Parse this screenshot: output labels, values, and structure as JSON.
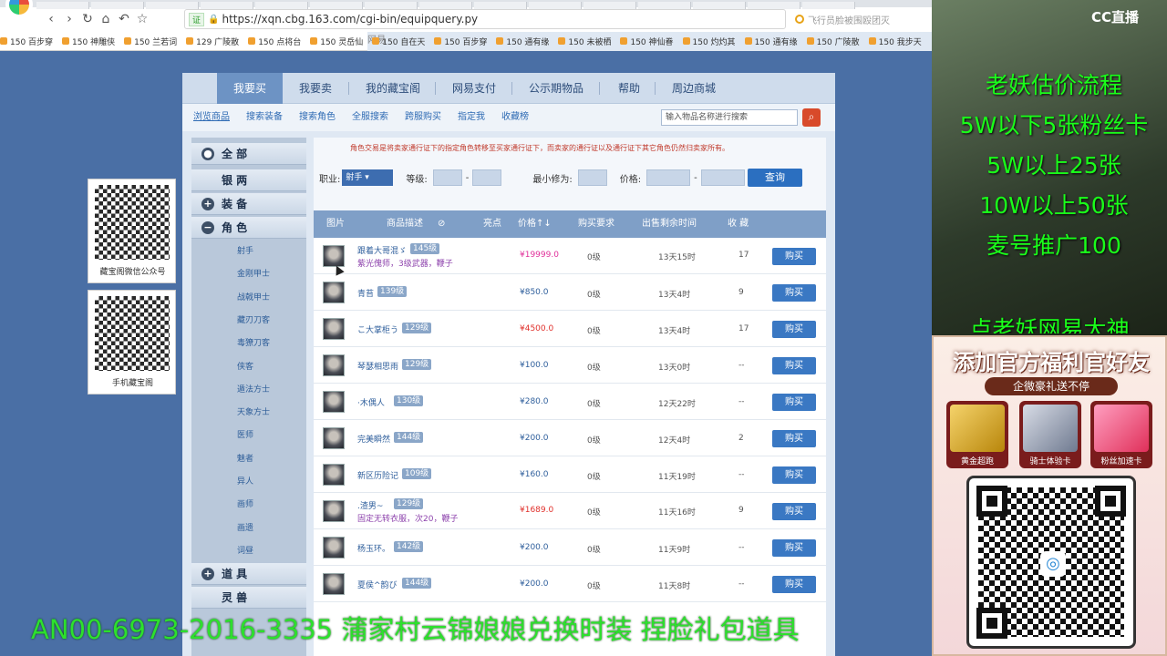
{
  "browser": {
    "url": "https://xqn.cbg.163.com/cgi-bin/equipquery.py",
    "site_tag": "网易",
    "cert_tag": "证",
    "search_hint": "飞行员脸被围殴团灭",
    "bookmarks": [
      "150 百步穿",
      "150 神雕侠",
      "150 兰若词",
      "129 广陵散",
      "150 点将台",
      "150 灵岳仙",
      "150 自在天",
      "150 百步穿",
      "150 通有缘",
      "150 未被栖",
      "150 神仙眷",
      "150 灼灼其",
      "150 通有缘",
      "150 广陵散",
      "150 我步天"
    ]
  },
  "site": {
    "tabs": [
      "我要买",
      "我要卖",
      "我的藏宝阁",
      "网易支付",
      "公示期物品",
      "帮助",
      "周边商城"
    ],
    "subnav": [
      "浏览商品",
      "搜索装备",
      "搜索角色",
      "全服搜索",
      "跨服购买",
      "指定我",
      "收藏榜"
    ],
    "search_placeholder": "输入物品名称进行搜索",
    "side": {
      "all": "全 部",
      "silver": "银 两",
      "equip": "装 备",
      "role": "角 色",
      "role_subs": [
        "射手",
        "金刚甲士",
        "战戟甲士",
        "藏刃刀客",
        "毒獠刀客",
        "侠客",
        "遁法方士",
        "天象方士",
        "医师",
        "魅者",
        "异人",
        "画师",
        "画遗",
        "词昼"
      ],
      "items": "道 具",
      "pets": "灵 兽"
    },
    "filter": {
      "notice": "角色交易是将卖家通行证下的指定角色转移至买家通行证下，而卖家的通行证以及通行证下其它角色仍然归卖家所有。",
      "job_label": "职业:",
      "job_value": "射手",
      "level_label": "等级:",
      "min_label": "最小修为:",
      "price_label": "价格:",
      "query_button": "查询"
    },
    "table": {
      "headers": [
        "图片",
        "商品描述",
        "⊘",
        "亮点",
        "价格↑↓",
        "购买要求",
        "出售剩余时间",
        "收 藏"
      ],
      "buy_label": "购买",
      "rows": [
        {
          "name": "跟着大哥混ゞ",
          "level": "145级",
          "desc": "紫光傀师，3级武器，鞭子",
          "price": "¥19999.0",
          "req": "0级",
          "time": "13天15时",
          "fav": "17"
        },
        {
          "name": "青苔",
          "level": "139级",
          "desc": "",
          "price": "¥850.0",
          "req": "0级",
          "time": "13天4时",
          "fav": "9"
        },
        {
          "name": "こ大掌柜う",
          "level": "129级",
          "desc": "",
          "price": "¥4500.0",
          "req": "0级",
          "time": "13天4时",
          "fav": "17"
        },
        {
          "name": "琴瑟相思雨",
          "level": "129级",
          "desc": "",
          "price": "¥100.0",
          "req": "0级",
          "time": "13天0时",
          "fav": "--"
        },
        {
          "name": "·木偶人",
          "level": "130级",
          "desc": "",
          "price": "¥280.0",
          "req": "0级",
          "time": "12天22时",
          "fav": "--"
        },
        {
          "name": "完美瞬然",
          "level": "144级",
          "desc": "",
          "price": "¥200.0",
          "req": "0级",
          "time": "12天4时",
          "fav": "2"
        },
        {
          "name": "新区历险记",
          "level": "109级",
          "desc": "",
          "price": "¥160.0",
          "req": "0级",
          "time": "11天19时",
          "fav": "--"
        },
        {
          "name": ".渣男~",
          "level": "129级",
          "desc": "固定无转衣服，次20，鞭子",
          "price": "¥1689.0",
          "req": "0级",
          "time": "11天16时",
          "fav": "9"
        },
        {
          "name": "杨玉环。",
          "level": "142级",
          "desc": "",
          "price": "¥200.0",
          "req": "0级",
          "time": "11天9时",
          "fav": "--"
        },
        {
          "name": "夏侯^韵び",
          "level": "144级",
          "desc": "",
          "price": "¥200.0",
          "req": "0级",
          "time": "11天8时",
          "fav": "--"
        }
      ]
    }
  },
  "qr_cards": [
    "藏宝阁微信公众号",
    "手机藏宝阁"
  ],
  "overlay_text": "AN00-6973-2016-3335 蒲家村云锦娘娘兑换时装 捏脸礼包道具",
  "stream": {
    "logo": "CC直播",
    "promo": [
      "老妖估价流程",
      "5W以下5张粉丝卡",
      "5W以上25张",
      "10W以上50张",
      "麦号推广100",
      "点老妖网易大神"
    ],
    "gift_title": "添加官方福利官好友",
    "gift_sub": "企微豪礼送不停",
    "gifts": [
      "黄金超跑",
      "骑士体验卡",
      "粉丝加速卡"
    ]
  },
  "colors": {
    "accent": "#2b6fc0",
    "price_red": "#e0302b",
    "promo_green": "#1aff1a"
  }
}
